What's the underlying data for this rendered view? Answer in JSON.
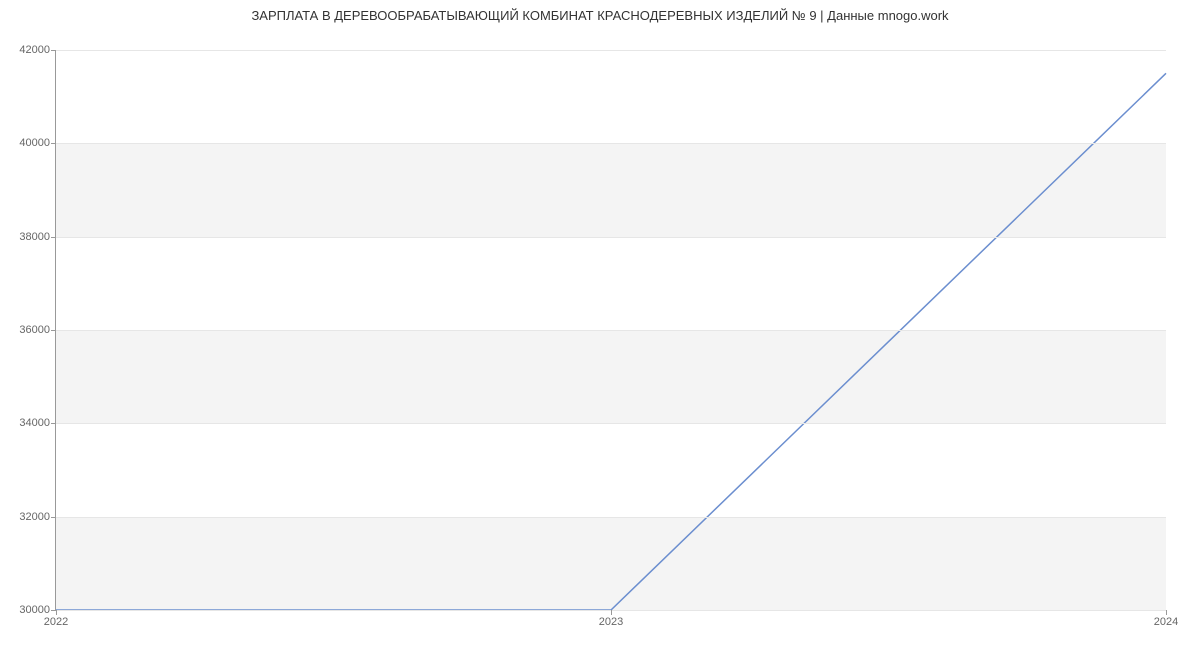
{
  "chart_data": {
    "type": "line",
    "title": "ЗАРПЛАТА В  ДЕРЕВООБРАБАТЫВАЮЩИЙ КОМБИНАТ КРАСНОДЕРЕВНЫХ ИЗДЕЛИЙ № 9 | Данные mnogo.work",
    "x": [
      2022,
      2023,
      2024
    ],
    "y": [
      30000,
      30000,
      41500
    ],
    "x_ticks": [
      2022,
      2023,
      2024
    ],
    "y_ticks": [
      30000,
      32000,
      34000,
      36000,
      38000,
      40000,
      42000
    ],
    "xlim": [
      2022,
      2024
    ],
    "ylim": [
      30000,
      42000
    ],
    "xlabel": "",
    "ylabel": "",
    "line_color": "#6b8ecf",
    "bands": true
  }
}
